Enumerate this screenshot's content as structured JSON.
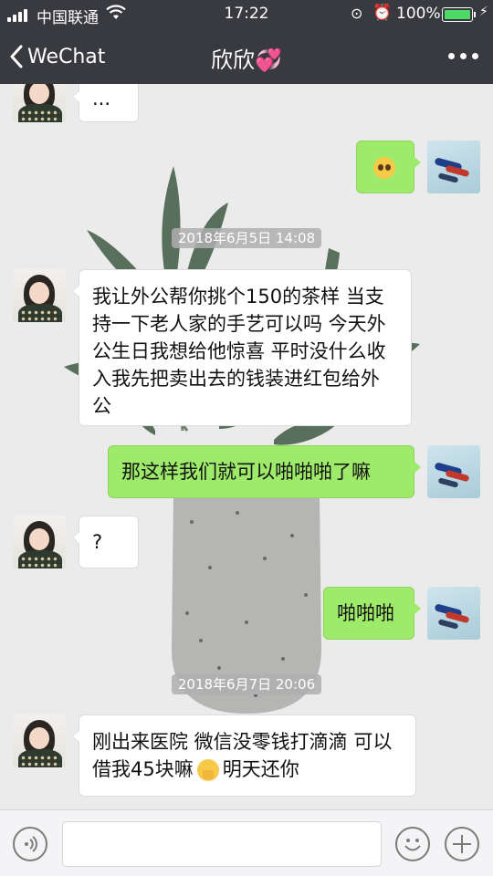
{
  "status_bar": {
    "carrier": "中国联通",
    "time": "17:22",
    "battery_percent": "100%"
  },
  "nav": {
    "back_label": "WeChat",
    "title": "欣欣💞"
  },
  "messages": [
    {
      "side": "left",
      "text": "..."
    },
    {
      "side": "right",
      "text": "",
      "emoji": "pleading-face-emoji"
    },
    {
      "side": "timestamp",
      "text": "2018年6月5日 14:08"
    },
    {
      "side": "left",
      "text": "我让外公帮你挑个150的茶样 当支持一下老人家的手艺可以吗 今天外公生日我想给他惊喜 平时没什么收入我先把卖出去的钱装进红包给外公"
    },
    {
      "side": "right",
      "text": "那这样我们就可以啪啪啪了嘛"
    },
    {
      "side": "left",
      "text": "?"
    },
    {
      "side": "right",
      "text": "啪啪啪"
    },
    {
      "side": "timestamp",
      "text": "2018年6月7日 20:06"
    },
    {
      "side": "left",
      "text_before": "刚出来医院 微信没零钱打滴滴 可以借我45块嘛",
      "emoji": "pray-emoji",
      "text_after": "明天还你"
    }
  ],
  "input_bar": {
    "placeholder": ""
  },
  "colors": {
    "header_bg": "#393a3f",
    "self_bubble": "#9eea6a",
    "other_bubble": "#ffffff",
    "chat_bg": "#ebebeb"
  }
}
